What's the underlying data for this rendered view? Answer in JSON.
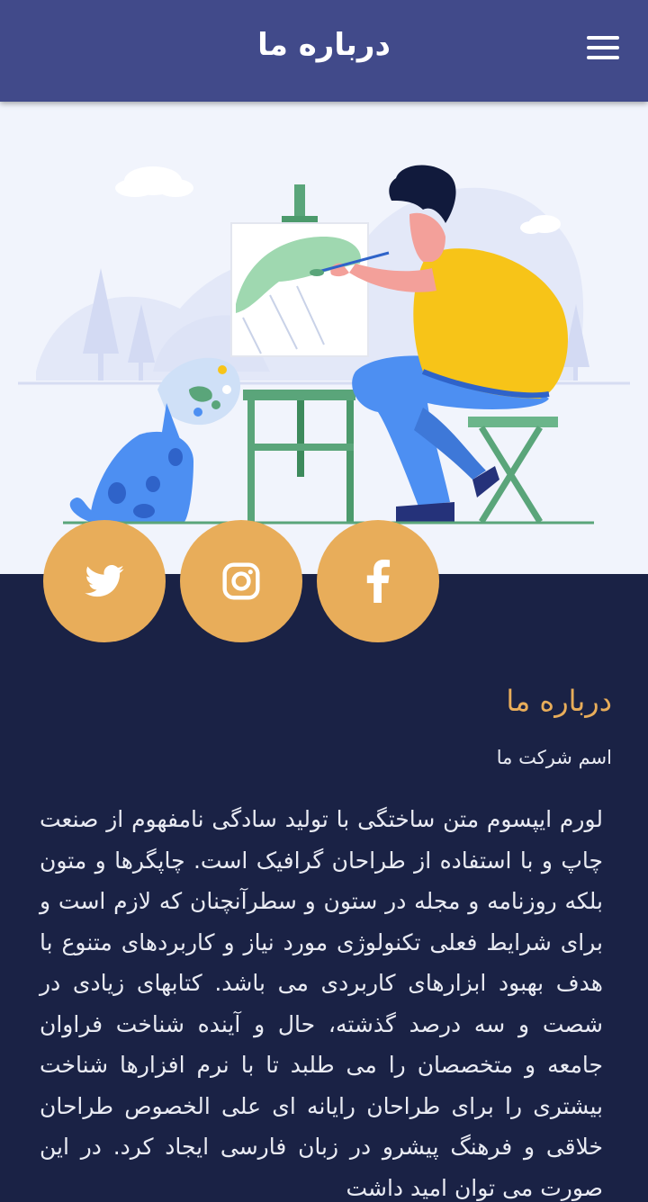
{
  "appbar": {
    "title": "درباره ما",
    "menu_icon": "hamburger-menu-icon"
  },
  "hero": {
    "illustration": "painter-with-easel-and-cat-illustration"
  },
  "social": [
    {
      "name": "twitter",
      "icon": "twitter-icon"
    },
    {
      "name": "instagram",
      "icon": "instagram-icon"
    },
    {
      "name": "facebook",
      "icon": "facebook-icon"
    }
  ],
  "about": {
    "title": "درباره ما",
    "subtitle": "اسم شرکت ما",
    "body": "لورم ایپسوم متن ساختگی با تولید سادگی نامفهوم از صنعت چاپ و با استفاده از طراحان گرافیک است. چاپگرها و متون بلکه روزنامه و مجله در ستون و سطرآنچنان که لازم است و برای شرایط فعلی تکنولوژی مورد نیاز و کاربردهای متنوع با هدف بهبود ابزارهای کاربردی می باشد. کتابهای زیادی در شصت و سه درصد گذشته، حال و آینده شناخت فراوان جامعه و متخصصان را می طلبد تا با نرم افزارها شناخت بیشتری را برای طراحان رایانه ای علی الخصوص طراحان خلاقی و فرهنگ پیشرو در زبان فارسی ایجاد کرد. در این صورت می توان امید داشت"
  },
  "colors": {
    "appbar": "#414a8a",
    "background": "#1a2245",
    "accent": "#e8ad5a",
    "hero_bg": "#f1f4fc"
  }
}
